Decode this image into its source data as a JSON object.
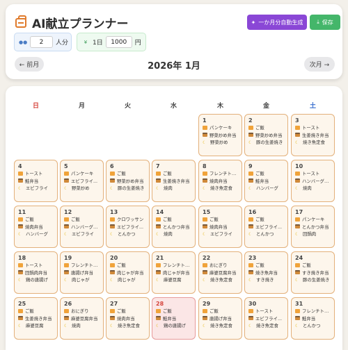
{
  "app": {
    "title": "AI献立プランナー",
    "auto_button": "一か月分自動生成",
    "save_button": "保存"
  },
  "people": {
    "value": "2",
    "unit": "人分"
  },
  "budget": {
    "prefix": "1日",
    "value": "1000",
    "unit": "円"
  },
  "nav": {
    "prev": "← 前月",
    "next": "次月 →",
    "month": "2026年 1月"
  },
  "weekdays": [
    "日",
    "月",
    "火",
    "水",
    "木",
    "金",
    "土"
  ],
  "today": "28",
  "days": [
    {
      "d": "1",
      "b": "パンケーキ",
      "l": "野菜炒め弁当",
      "n": "野菜炒め"
    },
    {
      "d": "2",
      "b": "ご飯",
      "l": "野菜炒め弁当",
      "n": "豚の生姜焼き"
    },
    {
      "d": "3",
      "b": "トースト",
      "l": "生姜焼き弁当",
      "n": "焼き魚定食"
    },
    {
      "d": "4",
      "b": "トースト",
      "l": "鮭弁当",
      "n": "エビフライ"
    },
    {
      "d": "5",
      "b": "パンケーキ",
      "l": "エビフライ...",
      "n": "野菜炒め"
    },
    {
      "d": "6",
      "b": "ご飯",
      "l": "野菜炒め弁当",
      "n": "豚の生姜焼き"
    },
    {
      "d": "7",
      "b": "ご飯",
      "l": "生姜焼き弁当",
      "n": "焼肉"
    },
    {
      "d": "8",
      "b": "フレンチトー...",
      "l": "焼肉弁当",
      "n": "焼き魚定食"
    },
    {
      "d": "9",
      "b": "ご飯",
      "l": "鮭弁当",
      "n": "ハンバーグ"
    },
    {
      "d": "10",
      "b": "トースト",
      "l": "ハンバーグ弁...",
      "n": "焼肉"
    },
    {
      "d": "11",
      "b": "ご飯",
      "l": "焼肉弁当",
      "n": "ハンバーグ"
    },
    {
      "d": "12",
      "b": "ご飯",
      "l": "ハンバーグ弁...",
      "n": "エビフライ"
    },
    {
      "d": "13",
      "b": "クロワッサン",
      "l": "エビフライ...",
      "n": "とんかつ"
    },
    {
      "d": "14",
      "b": "ご飯",
      "l": "とんかつ弁当",
      "n": "焼肉"
    },
    {
      "d": "15",
      "b": "ご飯",
      "l": "焼肉弁当",
      "n": "エビフライ"
    },
    {
      "d": "16",
      "b": "ご飯",
      "l": "エビフライ...",
      "n": "とんかつ"
    },
    {
      "d": "17",
      "b": "パンケーキ",
      "l": "とんかつ弁当",
      "n": "回鍋肉"
    },
    {
      "d": "18",
      "b": "トースト",
      "l": "回鍋肉弁当",
      "n": "鶏の唐揚げ"
    },
    {
      "d": "19",
      "b": "フレンチトー...",
      "l": "唐揚げ弁当",
      "n": "肉じゃが"
    },
    {
      "d": "20",
      "b": "ご飯",
      "l": "肉じゃが弁当",
      "n": "肉じゃが"
    },
    {
      "d": "21",
      "b": "フレンチトー...",
      "l": "肉じゃが弁当",
      "n": "麻婆豆腐"
    },
    {
      "d": "22",
      "b": "おにぎり",
      "l": "麻婆豆腐弁当",
      "n": "焼き魚定食"
    },
    {
      "d": "23",
      "b": "ご飯",
      "l": "焼き魚弁当",
      "n": "すき焼き"
    },
    {
      "d": "24",
      "b": "ご飯",
      "l": "すき焼き弁当",
      "n": "豚の生姜焼き"
    },
    {
      "d": "25",
      "b": "ご飯",
      "l": "生姜焼き弁当",
      "n": "麻婆豆腐"
    },
    {
      "d": "26",
      "b": "おにぎり",
      "l": "麻婆豆腐弁当",
      "n": "焼肉"
    },
    {
      "d": "27",
      "b": "ご飯",
      "l": "焼肉弁当",
      "n": "焼き魚定食"
    },
    {
      "d": "28",
      "b": "ご飯",
      "l": "鮭弁当",
      "n": "鶏の唐揚げ"
    },
    {
      "d": "29",
      "b": "ご飯",
      "l": "唐揚げ弁当",
      "n": "焼き魚定食"
    },
    {
      "d": "30",
      "b": "トースト",
      "l": "エビフライ...",
      "n": "焼き魚定食"
    },
    {
      "d": "31",
      "b": "フレンチトー...",
      "l": "鮭弁当",
      "n": "とんかつ"
    }
  ]
}
